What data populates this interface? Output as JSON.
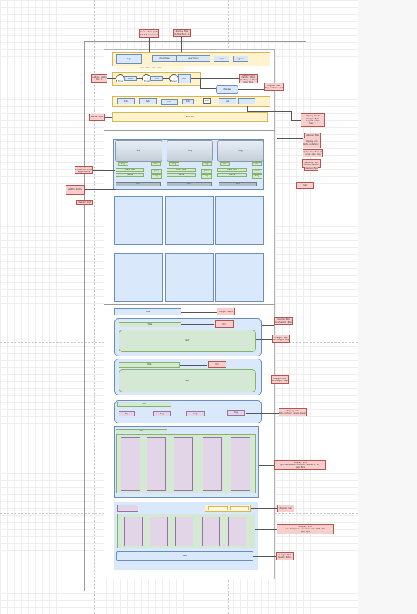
{
  "diagram": {
    "header_pills": {
      "logo": "logo",
      "pill_b": "dropdown",
      "pill_c": "searchbox",
      "pill_d": "login",
      "pill_e": "signup"
    },
    "nav_caption": "nav · nav · nav · nav",
    "step_labels": [
      "icon",
      "icon",
      "icon"
    ],
    "step_tags": [
      "hover",
      "hover",
      "hover"
    ],
    "stepper_label": "stepper",
    "tab_items": [
      "tab",
      "tab",
      "tab",
      "tab",
      "tab",
      "tab"
    ],
    "info_bar": "info bar",
    "card_img": "img",
    "card_tag": "tag",
    "card_title": "CardTitle",
    "card_pills": [
      "name",
      "price",
      "tag"
    ],
    "card_btn": "btn",
    "section_heading": "title",
    "panel_headings": [
      "title",
      "title"
    ],
    "panel_badges": [
      "btn",
      "btn"
    ],
    "panel_body": "text",
    "filter_heading": "title",
    "filter_chips": [
      "tag",
      "tag",
      "tag",
      "tag",
      "tag"
    ],
    "grid_heading": "title",
    "footer_text": "text",
    "annotations": [
      "focus: show-path\nopt. tab nav select",
      "display: flex\nflex-direction: row",
      "position: sticky\ntop: 0",
      "display: flex\nheight: 36px\npadding: 0 12px\ngap: 8px",
      "display: flex\njustify-content: center",
      "border: 1px",
      "display: block\nmargin: 8px\nheight: 24px\nflex: 1",
      "display: flex",
      "display: grid\ngrid-template-columns: 1fr 1fr 1fr",
      "display: flex; flex-wrap\nwrap; gap: 8px",
      "padding: 8px\nborder-radius",
      "display: flex",
      "display: flex\nflex-direction: column\nalign-items",
      "width: 100%",
      "display: grid",
      "gap",
      "margin: 24px",
      "margin: 8px\nmin-height: 40px",
      "margin: 8px\nmin-height: 40px",
      "display: flex\njustify-content: space-between",
      "display: grid\ngrid-template-columns: repeat(5, 1fr)\ngap: 8px",
      "display: flex",
      "display: grid\ngrid-template-columns: repeat(5, 1fr)\ngap: 8px",
      "margin: 8px\nheight: 40px"
    ]
  },
  "colors": {
    "yellow_fill": "#fff2cc",
    "blue_fill": "#dae8fc",
    "green_fill": "#d5e8d4",
    "purple_fill": "#e1d5e7",
    "red_fill": "#f8cecc"
  }
}
